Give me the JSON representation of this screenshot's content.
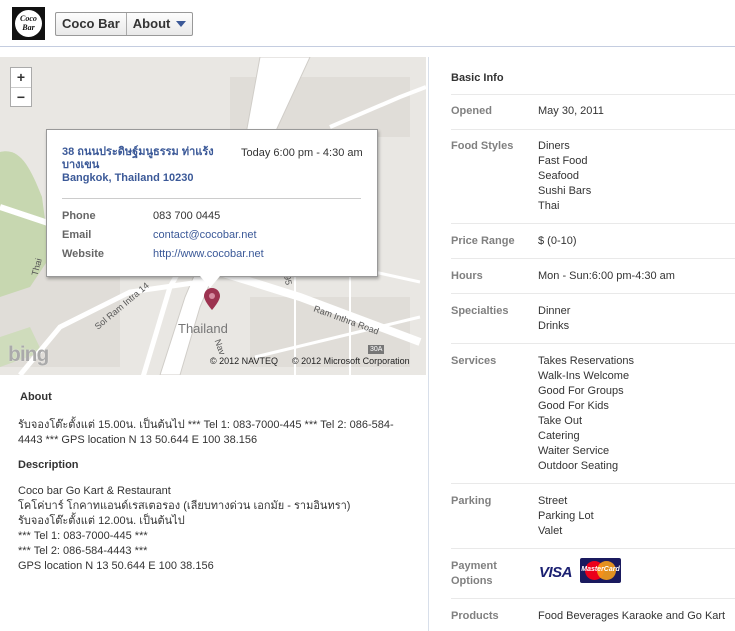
{
  "header": {
    "logo_line1": "Coco",
    "logo_line2": "Bar",
    "breadcrumb_page": "Coco Bar",
    "breadcrumb_section": "About"
  },
  "map": {
    "zoom_in": "+",
    "zoom_out": "−",
    "popup": {
      "address_line1": "38 ถนนประดิษฐ์มนูธรรม ท่าแร้ง บางเขน",
      "address_line2": "Bangkok, Thailand 10230",
      "hours_today": "Today 6:00 pm - 4:30 am",
      "phone_label": "Phone",
      "phone_value": "083 700 0445",
      "email_label": "Email",
      "email_value": "contact@cocobar.net",
      "website_label": "Website",
      "website_value": "http://www.cocobar.net"
    },
    "labels": {
      "country": "Thailand",
      "road1": "Sol Ram Intra 14",
      "road2": "Ram Inthra Road",
      "road3": "Thai",
      "road4": "95",
      "road5": "Nav",
      "shield1": "30A",
      "shield2": "30A"
    },
    "provider_logo": "bing",
    "copyright1": "© 2012 NAVTEQ",
    "copyright2": "© 2012 Microsoft Corporation"
  },
  "about": {
    "title": "About",
    "text": "รับจองโต๊ะตั้งแต่ 15.00น. เป็นต้นไป *** Tel 1: 083-7000-445 *** Tel 2: 086-584-4443 *** GPS location N 13 50.644 E 100 38.156",
    "description_title": "Description",
    "description_text": "Coco bar Go Kart & Restaurant\nโคโค่บาร์ โกคาทแอนด์เรสเตอรอง (เลียบทางด่วน เอกมัย - รามอินทรา)\nรับจองโต๊ะตั้งแต่ 12.00น. เป็นต้นไป\n*** Tel 1: 083-7000-445 ***\n*** Tel 2: 086-584-4443 ***\nGPS location N 13 50.644 E 100 38.156"
  },
  "basic_info": {
    "title": "Basic Info",
    "opened_label": "Opened",
    "opened_value": "May 30, 2011",
    "food_styles_label": "Food Styles",
    "food_styles": [
      "Diners",
      "Fast Food",
      "Seafood",
      "Sushi Bars",
      "Thai"
    ],
    "price_label": "Price Range",
    "price_value": "$ (0-10)",
    "hours_label": "Hours",
    "hours_value": "Mon - Sun:6:00 pm-4:30 am",
    "specialties_label": "Specialties",
    "specialties": [
      "Dinner",
      "Drinks"
    ],
    "services_label": "Services",
    "services": [
      "Takes Reservations",
      "Walk-Ins Welcome",
      "Good For Groups",
      "Good For Kids",
      "Take Out",
      "Catering",
      "Waiter Service",
      "Outdoor Seating"
    ],
    "parking_label": "Parking",
    "parking": [
      "Street",
      "Parking Lot",
      "Valet"
    ],
    "payment_label_line1": "Payment",
    "payment_label_line2": "Options",
    "payment_visa": "VISA",
    "payment_mastercard": "MasterCard",
    "products_label": "Products",
    "products_value": "Food Beverages Karaoke and Go Kart"
  },
  "colors": {
    "link": "#3b5998",
    "label_gray": "#808080",
    "border": "#c4cde0"
  }
}
